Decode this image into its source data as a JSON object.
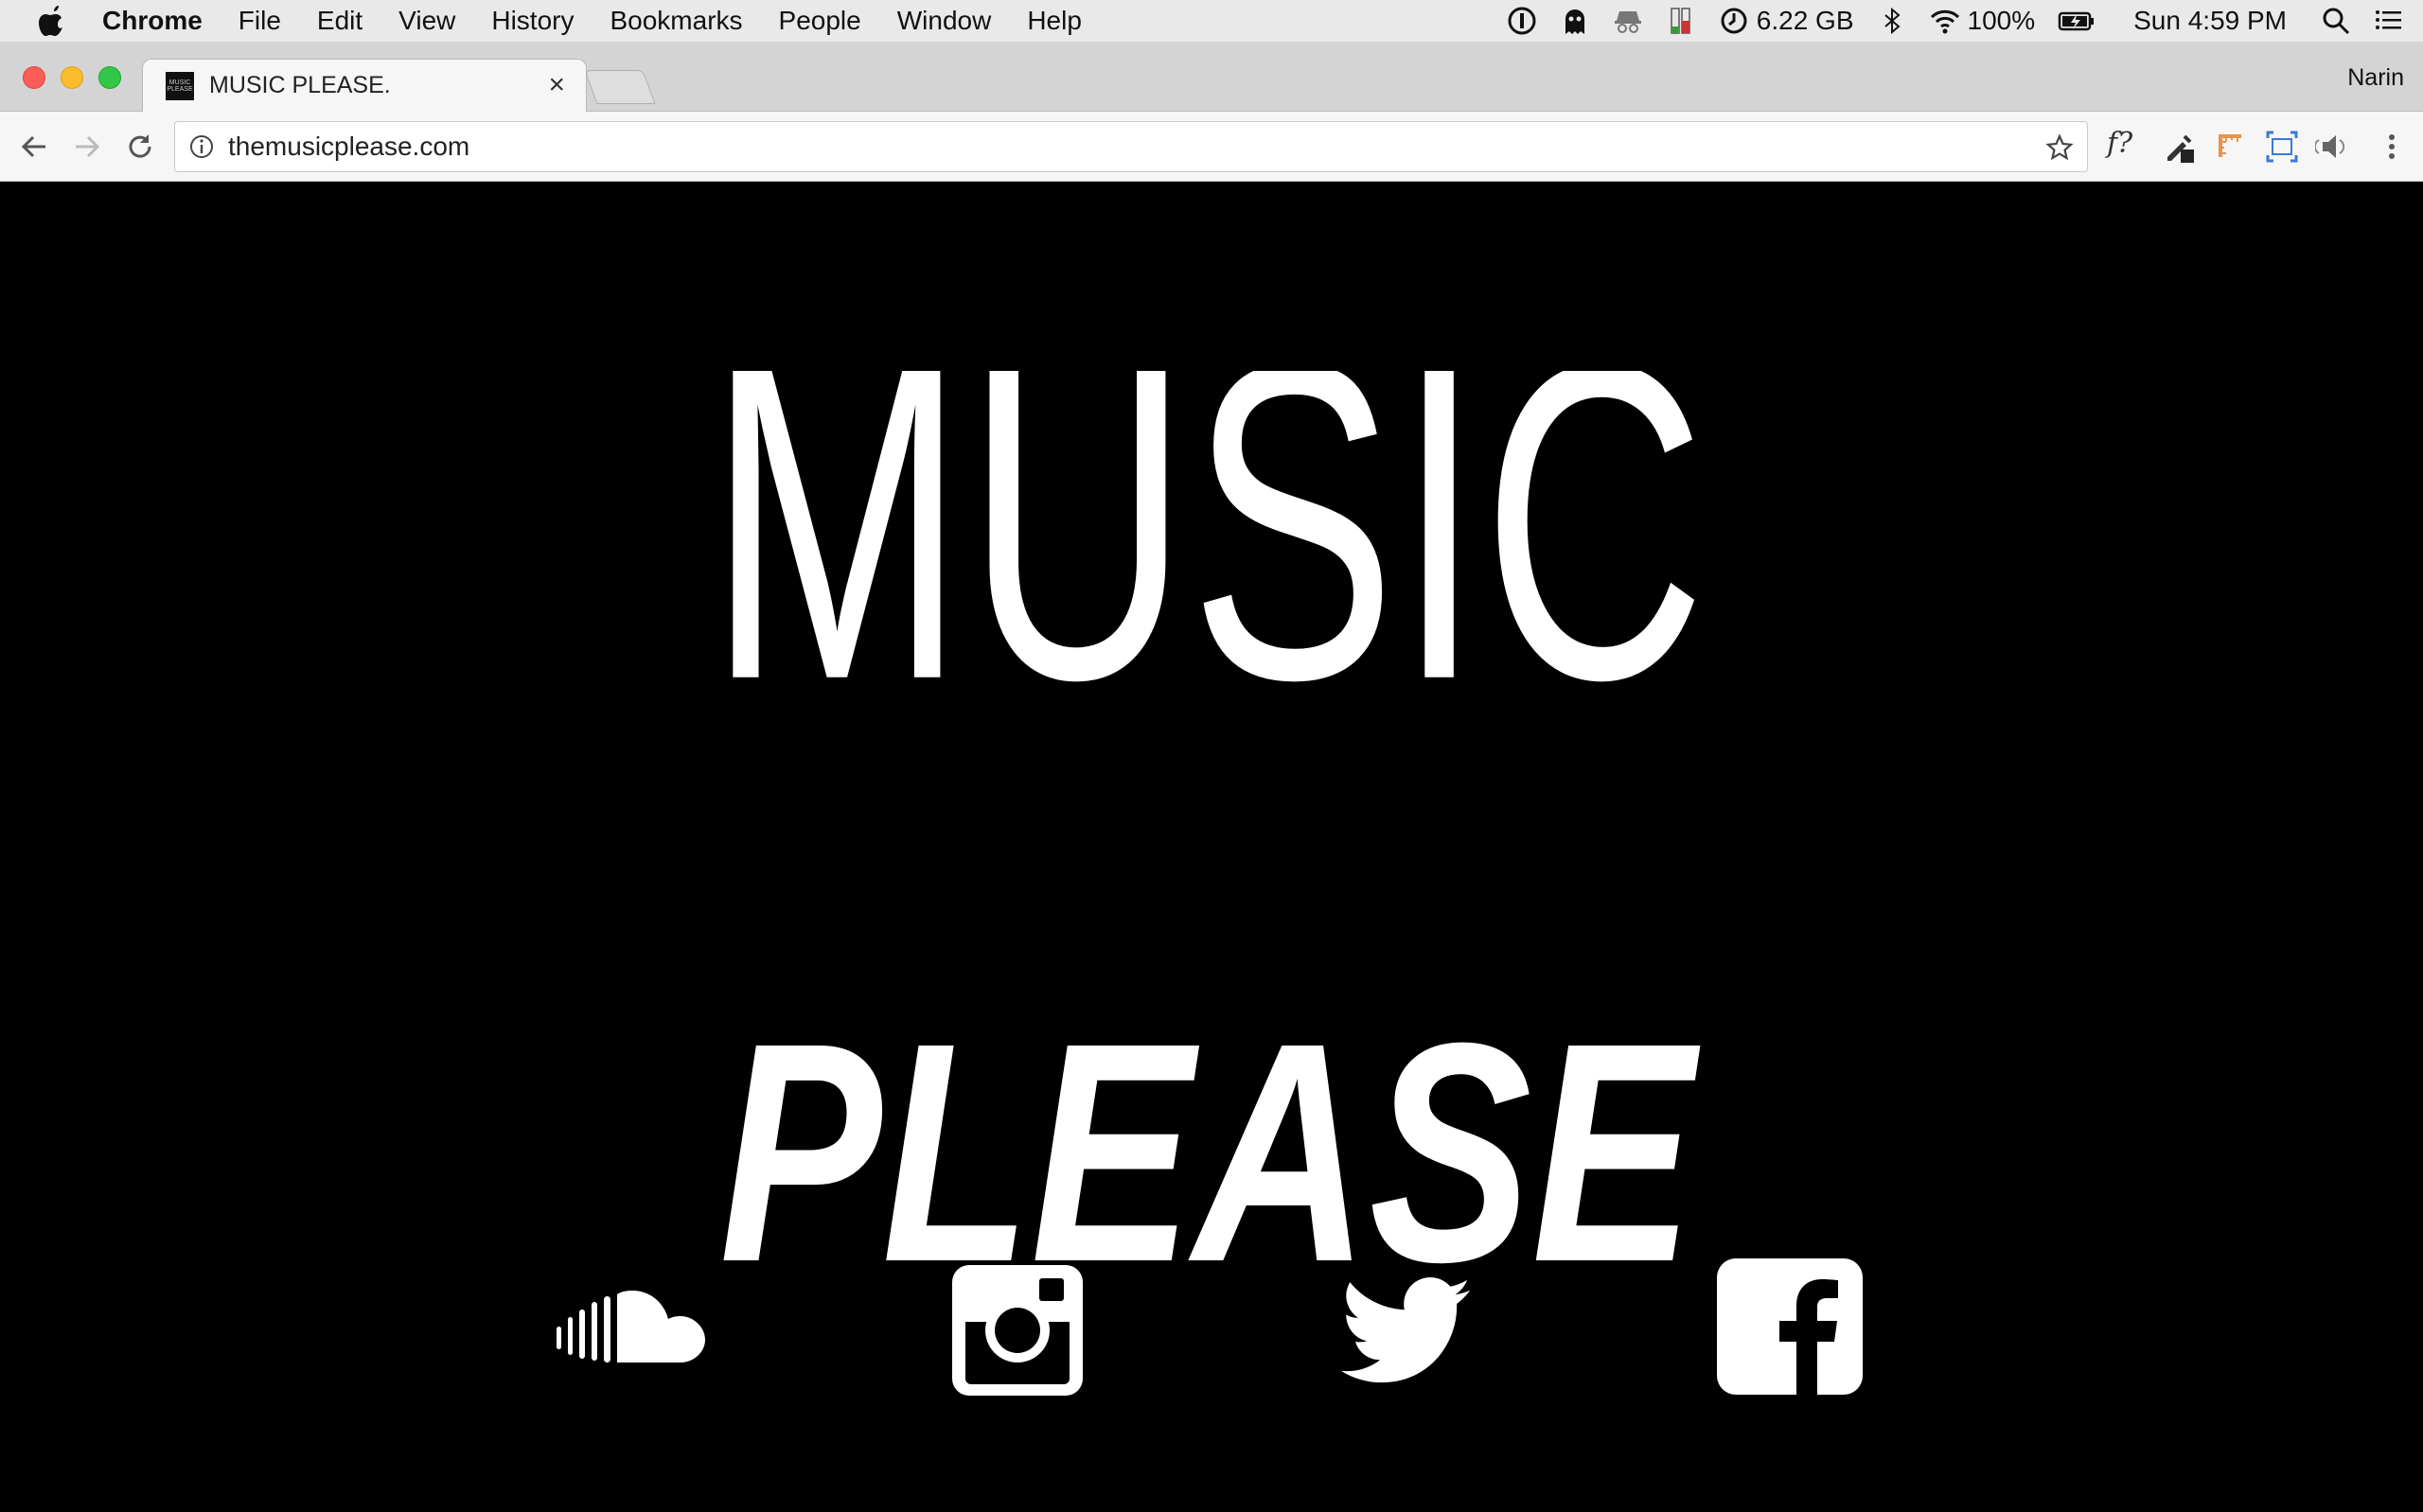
{
  "menubar": {
    "app_name": "Chrome",
    "items": [
      "File",
      "Edit",
      "View",
      "History",
      "Bookmarks",
      "People",
      "Window",
      "Help"
    ],
    "memory": "6.22 GB",
    "battery": "100%",
    "clock": "Sun 4:59 PM"
  },
  "browser": {
    "tab_title": "MUSIC PLEASE.",
    "favicon_text": "MUSIC PLEASE",
    "profile_name": "Narin",
    "url": "themusicplease.com",
    "ext_font_label": "f?"
  },
  "page": {
    "logo_line1": "MUSIC",
    "logo_line2": "PLEASE",
    "social": [
      "soundcloud-icon",
      "instagram-icon",
      "twitter-icon",
      "facebook-icon"
    ]
  },
  "colors": {
    "page_bg": "#000000",
    "logo": "#ffffff",
    "menubar_bg": "#e9e9e9",
    "tabstrip_bg": "#d4d4d4",
    "toolbar_bg": "#f6f6f6"
  }
}
